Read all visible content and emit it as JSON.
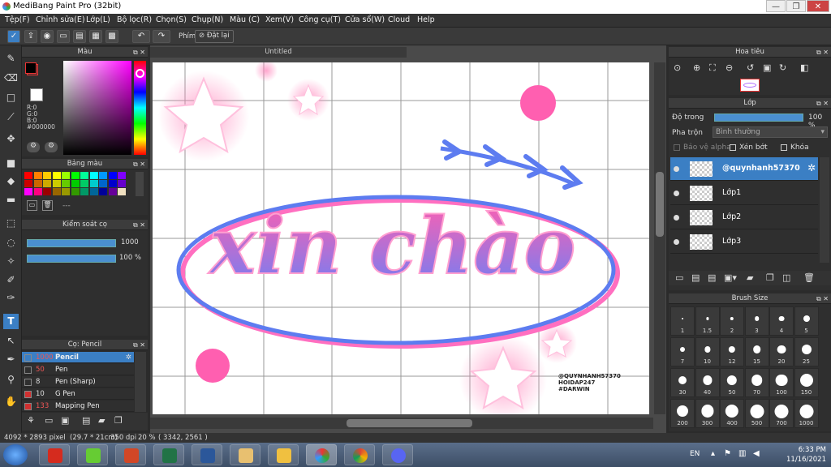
{
  "window": {
    "title": "MediBang Paint Pro (32bit)",
    "min": "—",
    "max": "❐",
    "close": "✕"
  },
  "menu": [
    "Tệp(F)",
    "Chỉnh sửa(E)",
    "Lớp(L)",
    "Bộ lọc(R)",
    "Chọn(S)",
    "Chụp(N)",
    "Màu (C)",
    "Xem(V)",
    "Công cụ(T)",
    "Cửa sổ(W)",
    "Cloud",
    "Help"
  ],
  "toolbar": {
    "phim_label": "Phím",
    "reset_label": "Đặt lại"
  },
  "color_panel": {
    "title": "Màu",
    "r": "R:0",
    "g": "G:0",
    "b": "B:0",
    "hex": "#000000",
    "fg": "#000000",
    "bg": "#ffffff"
  },
  "palette_panel": {
    "title": "Bảng màu",
    "more": "---"
  },
  "brush_control": {
    "title": "Kiểm soát cọ",
    "size": "1000",
    "opacity": "100 %"
  },
  "brush_list": {
    "title": "Cọ: Pencil",
    "items": [
      {
        "size": "1000",
        "name": "Pencil",
        "color": "#3b7fc4"
      },
      {
        "size": "50",
        "name": "Pen",
        "color": "#2f2f2f"
      },
      {
        "size": "8",
        "name": "Pen (Sharp)",
        "color": "#2f2f2f"
      },
      {
        "size": "10",
        "name": "G Pen",
        "color": "#d03030"
      },
      {
        "size": "133",
        "name": "Mapping Pen",
        "color": "#d03030"
      }
    ]
  },
  "canvas": {
    "tab": "Untitled",
    "text_main": "xin chào",
    "watermark": [
      "@QUYNHANH57370",
      "HOIDAP247",
      "#DARWIN"
    ]
  },
  "navigator": {
    "title": "Hoa tiêu"
  },
  "layers": {
    "title": "Lớp",
    "opacity_label": "Độ trong",
    "opacity_value": "100 %",
    "opacity_fraction": 1.0,
    "blend_label": "Pha trộn",
    "blend_value": "Bình thường",
    "protect_alpha": "Bảo vệ alpha",
    "clipping": "Xén bớt",
    "lock": "Khóa",
    "items": [
      {
        "name": "@quynhanh57370",
        "selected": true
      },
      {
        "name": "Lớp1",
        "selected": false
      },
      {
        "name": "Lớp2",
        "selected": false
      },
      {
        "name": "Lớp3",
        "selected": false
      }
    ]
  },
  "brush_size": {
    "title": "Brush Size",
    "sizes": [
      "1",
      "1.5",
      "2",
      "3",
      "4",
      "5",
      "7",
      "10",
      "12",
      "15",
      "20",
      "25",
      "30",
      "40",
      "50",
      "70",
      "100",
      "150",
      "200",
      "300",
      "400",
      "500",
      "700",
      "1000"
    ]
  },
  "status": {
    "dims": "4092 * 2893 pixel",
    "cm": "(29.7 * 21cm)",
    "dpi": "350 dpi",
    "zoom": "20 %",
    "coords": "( 3342, 2561 )"
  },
  "taskbar": {
    "lang": "EN",
    "time": "6:33 PM",
    "date": "11/16/2021"
  }
}
